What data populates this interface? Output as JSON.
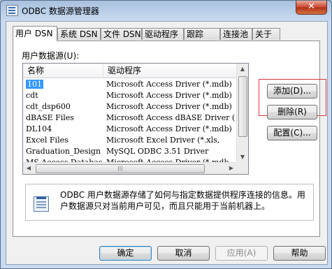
{
  "window": {
    "title": "ODBC 数据源管理器",
    "close_glyph": "✕"
  },
  "tabs": [
    {
      "label": "用户 DSN",
      "active": true
    },
    {
      "label": "系统 DSN",
      "active": false
    },
    {
      "label": "文件 DSN",
      "active": false
    },
    {
      "label": "驱动程序",
      "active": false
    },
    {
      "label": "跟踪",
      "active": false
    },
    {
      "label": "连接池",
      "active": false
    },
    {
      "label": "关于",
      "active": false
    }
  ],
  "panel": {
    "section_label": "用户数据源(U):",
    "columns": [
      "名称",
      "驱动程序"
    ],
    "rows": [
      {
        "name": "101",
        "driver": "Microsoft Access Driver (*.mdb)",
        "selected": true
      },
      {
        "name": "cdt",
        "driver": "Microsoft Access Driver (*.mdb)",
        "selected": false
      },
      {
        "name": "cdt_dsp600",
        "driver": "Microsoft Access Driver (*.mdb)",
        "selected": false
      },
      {
        "name": "dBASE Files",
        "driver": "Microsoft Access dBASE Driver (",
        "selected": false
      },
      {
        "name": "DL104",
        "driver": "Microsoft Access Driver (*.mdb)",
        "selected": false
      },
      {
        "name": "Excel Files",
        "driver": "Microsoft Excel Driver (*.xls,",
        "selected": false
      },
      {
        "name": "Graduation_Design",
        "driver": "MySQL ODBC 3.51 Driver",
        "selected": false
      },
      {
        "name": "MS Access Database",
        "driver": "Microsoft Access Driver (*.mdb,",
        "selected": false
      }
    ],
    "side_buttons": {
      "add": "添加(D)...",
      "remove": "删除(R)",
      "configure": "配置(C)..."
    },
    "info_text": "ODBC 用户数据源存储了如何与指定数据提供程序连接的信息。用户数据源只对当前用户可见，而且只能用于当前机器上。"
  },
  "footer": {
    "ok": "确定",
    "cancel": "取消",
    "apply": "应用(A)",
    "help": "帮助"
  },
  "colors": {
    "selection": "#3399ff",
    "highlight_box": "#d9363e",
    "close_button": "#c9462c"
  }
}
